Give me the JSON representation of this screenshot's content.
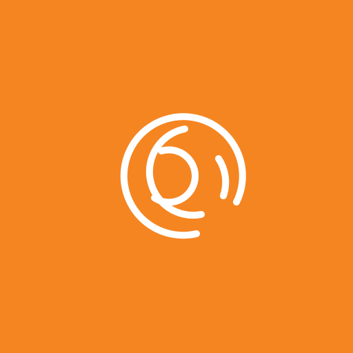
{
  "colors": {
    "background": "#F58521",
    "mark": "#FFFFFF"
  },
  "logo": {
    "icon": "concentric-open-rings-icon"
  }
}
